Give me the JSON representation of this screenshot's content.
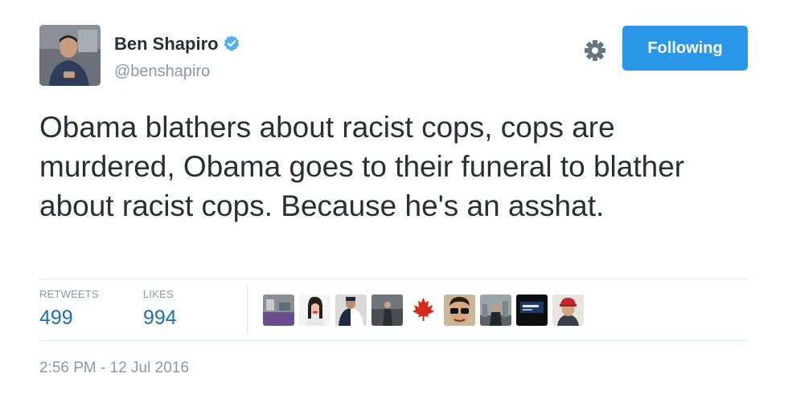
{
  "author": {
    "display_name": "Ben Shapiro",
    "handle": "@benshapiro",
    "verified": true
  },
  "actions": {
    "follow_label": "Following"
  },
  "tweet": {
    "text": "Obama blathers about racist cops, cops are murdered, Obama goes to their funeral to blather about racist cops. Because he's an asshat.",
    "timestamp": "2:56 PM - 12 Jul 2016"
  },
  "stats": {
    "retweets_label": "RETWEETS",
    "retweets_count": "499",
    "likes_label": "LIKES",
    "likes_count": "994"
  },
  "colors": {
    "accent": "#2b97e8",
    "stat_value": "#1b6fae",
    "muted": "#8899a6",
    "text": "#292f33",
    "divider": "#e1e8ed"
  }
}
